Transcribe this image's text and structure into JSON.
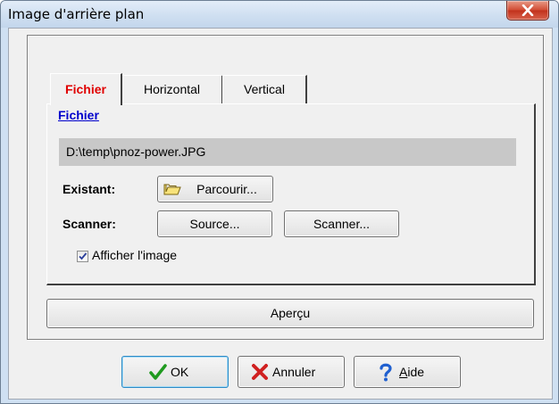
{
  "window": {
    "title": "Image d'arrière plan"
  },
  "tabs": [
    {
      "label": "Fichier",
      "active": true
    },
    {
      "label": "Horizontal",
      "active": false
    },
    {
      "label": "Vertical",
      "active": false
    }
  ],
  "file": {
    "section_label": "Fichier",
    "path": "D:\\temp\\pnoz-power.JPG",
    "existing_label": "Existant:",
    "browse_label": "Parcourir...",
    "scanner_label": "Scanner:",
    "source_button": "Source...",
    "scan_button": "Scanner...",
    "show_image_label": "Afficher l'image",
    "show_image_checked": true
  },
  "preview_button": "Aperçu",
  "footer": {
    "ok_label": "OK",
    "cancel_label": "Annuler",
    "help_label_first": "A",
    "help_label_rest": "ide"
  },
  "colors": {
    "active_tab": "#e00000",
    "link": "#0000cc",
    "close_button": "#c2321c",
    "ok_icon": "#1f9a1f",
    "cancel_icon": "#d02020",
    "help_icon": "#2060d0"
  },
  "icons": {
    "close": "close-icon",
    "browse": "folder-icon",
    "ok": "checkmark-icon",
    "cancel": "x-icon",
    "help": "question-icon"
  }
}
